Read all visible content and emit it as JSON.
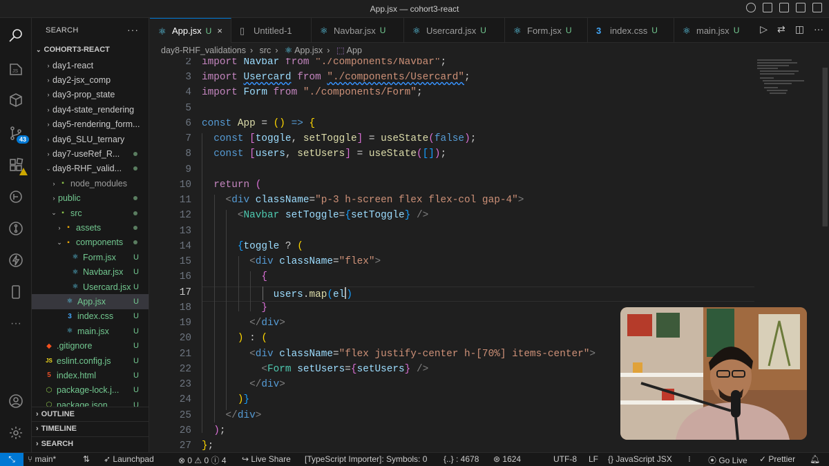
{
  "window": {
    "title": "App.jsx — cohort3-react"
  },
  "sidebar": {
    "header": "SEARCH",
    "root": "COHORT3-REACT",
    "items": [
      {
        "label": "day1-react"
      },
      {
        "label": "day2-jsx_comp"
      },
      {
        "label": "day3-prop_state"
      },
      {
        "label": "day4-state_rendering"
      },
      {
        "label": "day5-rendering_form..."
      },
      {
        "label": "day6_SLU_ternary"
      },
      {
        "label": "day7-useRef_R..."
      },
      {
        "label": "day8-RHF_valid..."
      },
      {
        "label": "node_modules"
      },
      {
        "label": "public"
      },
      {
        "label": "src"
      },
      {
        "label": "assets"
      },
      {
        "label": "components"
      },
      {
        "label": "Form.jsx",
        "status": "U"
      },
      {
        "label": "Navbar.jsx",
        "status": "U"
      },
      {
        "label": "Usercard.jsx",
        "status": "U"
      },
      {
        "label": "App.jsx",
        "status": "U"
      },
      {
        "label": "index.css",
        "status": "U"
      },
      {
        "label": "main.jsx",
        "status": "U"
      },
      {
        "label": ".gitignore",
        "status": "U"
      },
      {
        "label": "eslint.config.js",
        "status": "U"
      },
      {
        "label": "index.html",
        "status": "U"
      },
      {
        "label": "package-lock.j...",
        "status": "U"
      },
      {
        "label": "package.json",
        "status": "U"
      }
    ],
    "sections": [
      "OUTLINE",
      "TIMELINE",
      "SEARCH"
    ],
    "scm_badge": "43"
  },
  "tabs": [
    {
      "label": "App.jsx",
      "status": "U",
      "close": "×"
    },
    {
      "label": "Untitled-1"
    },
    {
      "label": "Navbar.jsx",
      "status": "U"
    },
    {
      "label": "Usercard.jsx",
      "status": "U"
    },
    {
      "label": "Form.jsx",
      "status": "U"
    },
    {
      "label": "index.css",
      "status": "U"
    },
    {
      "label": "main.jsx",
      "status": "U"
    }
  ],
  "breadcrumb": [
    "day8-RHF_validations",
    "src",
    "App.jsx",
    "App"
  ],
  "editor": {
    "line_numbers": [
      "2",
      "3",
      "4",
      "5",
      "6",
      "7",
      "8",
      "9",
      "10",
      "11",
      "12",
      "13",
      "14",
      "15",
      "16",
      "17",
      "18",
      "19",
      "20",
      "21",
      "22",
      "23",
      "24",
      "25",
      "26",
      "27"
    ],
    "current_line": "17"
  },
  "statusbar": {
    "branch": "main*",
    "launchpad": "Launchpad",
    "errors": "0",
    "warnings": "0",
    "info": "4",
    "live_share": "Live Share",
    "ts_importer": "[TypeScript Importer]: Symbols: 0",
    "braces": "{..} : 4678",
    "lines": "1624",
    "encoding": "UTF-8",
    "eol": "LF",
    "language": "JavaScript JSX",
    "go_live": "Go Live",
    "prettier": "Prettier"
  },
  "colors": {
    "accent": "#0078d4",
    "untracked": "#73c991"
  }
}
